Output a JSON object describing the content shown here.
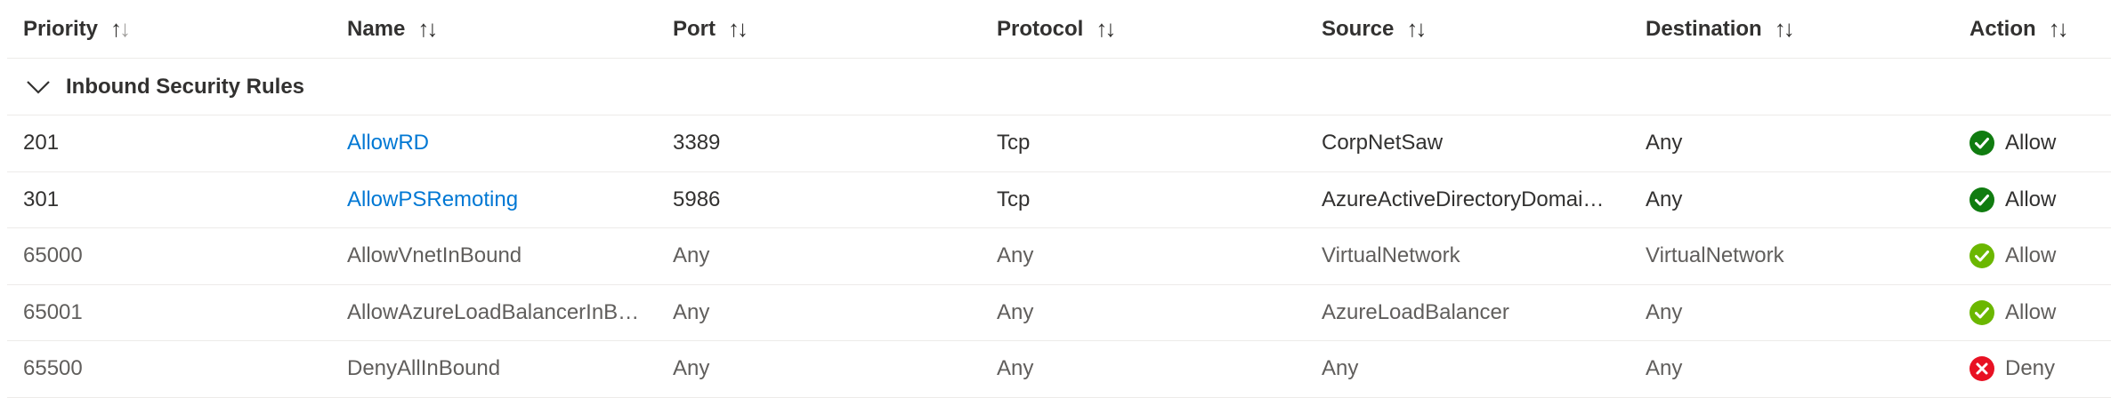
{
  "columns": {
    "priority": "Priority",
    "name": "Name",
    "port": "Port",
    "protocol": "Protocol",
    "source": "Source",
    "destination": "Destination",
    "action": "Action"
  },
  "sort_icon": {
    "up": "↑",
    "down": "↓"
  },
  "group": {
    "label": "Inbound Security Rules",
    "expanded": true,
    "icon": "chevron-down-icon"
  },
  "rules": [
    {
      "priority": "201",
      "name": "AllowRD",
      "port": "3389",
      "protocol": "Tcp",
      "source": "CorpNetSaw",
      "destination": "Any",
      "action": "Allow",
      "status": "allow",
      "custom": true
    },
    {
      "priority": "301",
      "name": "AllowPSRemoting",
      "port": "5986",
      "protocol": "Tcp",
      "source": "AzureActiveDirectoryDomai…",
      "destination": "Any",
      "action": "Allow",
      "status": "allow",
      "custom": true
    },
    {
      "priority": "65000",
      "name": "AllowVnetInBound",
      "port": "Any",
      "protocol": "Any",
      "source": "VirtualNetwork",
      "destination": "VirtualNetwork",
      "action": "Allow",
      "status": "allow",
      "custom": false
    },
    {
      "priority": "65001",
      "name": "AllowAzureLoadBalancerInB…",
      "port": "Any",
      "protocol": "Any",
      "source": "AzureLoadBalancer",
      "destination": "Any",
      "action": "Allow",
      "status": "allow",
      "custom": false
    },
    {
      "priority": "65500",
      "name": "DenyAllInBound",
      "port": "Any",
      "protocol": "Any",
      "source": "Any",
      "destination": "Any",
      "action": "Deny",
      "status": "deny",
      "custom": false
    }
  ],
  "colors": {
    "link": "#0078d4",
    "allow_custom": "#107c10",
    "allow_default": "#6bb700",
    "deny": "#e81123",
    "border": "#edebe9"
  }
}
